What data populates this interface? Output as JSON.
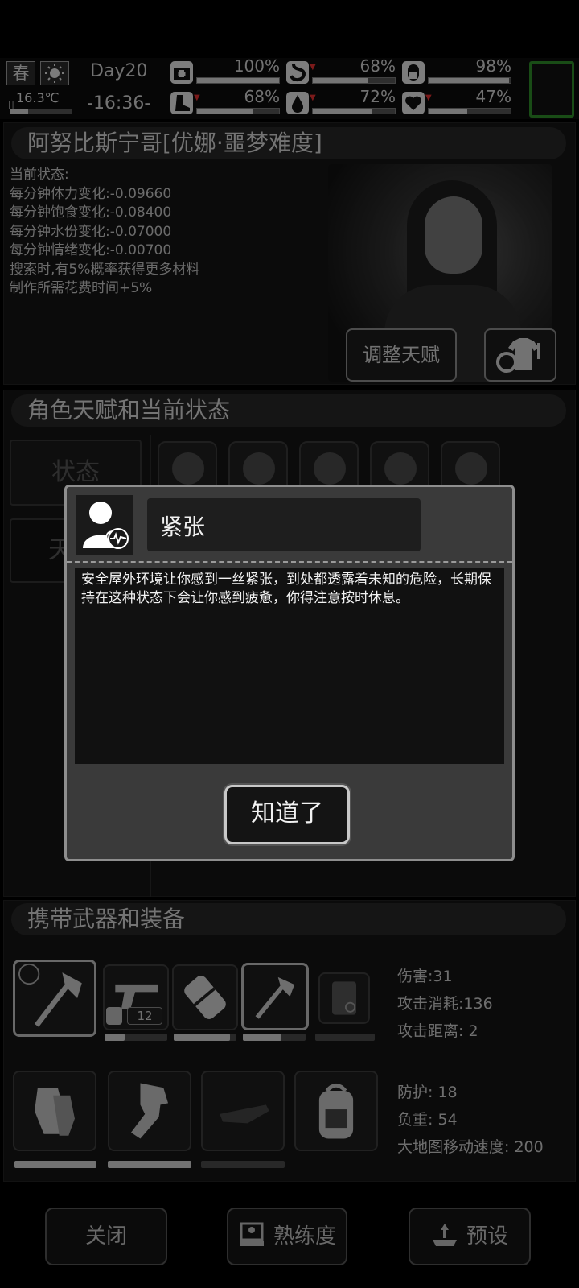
{
  "hud": {
    "season": "春",
    "temperature": "16.3℃",
    "temperature_level": 0.3,
    "day": "Day20",
    "time": "-16:36-",
    "stats": [
      {
        "name": "health",
        "icon": "medkit-icon",
        "value": "100%",
        "level": 1.0,
        "down": false
      },
      {
        "name": "hunger",
        "icon": "stomach-icon",
        "value": "68%",
        "level": 0.68,
        "down": true
      },
      {
        "name": "pill",
        "icon": "pill-icon",
        "value": "98%",
        "level": 0.98,
        "down": false
      },
      {
        "name": "stamina",
        "icon": "boot-icon",
        "value": "68%",
        "level": 0.68,
        "down": true
      },
      {
        "name": "thirst",
        "icon": "water-drop-icon",
        "value": "72%",
        "level": 0.72,
        "down": true
      },
      {
        "name": "mood",
        "icon": "heart-icon",
        "value": "47%",
        "level": 0.47,
        "down": true
      }
    ]
  },
  "character": {
    "name_header": "阿努比斯宁哥[优娜·噩梦难度]",
    "status_lines": [
      "当前状态:",
      "每分钟体力变化:-0.09660",
      "每分钟饱食变化:-0.08400",
      "每分钟水份变化:-0.07000",
      "每分钟情绪变化:-0.00700",
      "搜索时,有5%概率获得更多材料",
      "制作所需花费时间+5%"
    ],
    "adjust_talent_label": "调整天赋"
  },
  "talents_section": {
    "header": "角色天赋和当前状态",
    "tab_state": "状态",
    "tab_talent_partial": "天"
  },
  "dialog": {
    "title": "紧张",
    "body": "安全屋外环境让你感到一丝紧张，到处都透露着未知的危险，长期保持在这种状态下会让你感到疲惫，你得注意按时休息。",
    "ok_label": "知道了"
  },
  "equipment": {
    "header": "携带武器和装备",
    "weapon_durability": [
      0.0,
      0.32,
      0.9,
      0.62,
      0.0
    ],
    "ammo_count": "12",
    "weapon_stats": [
      "伤害:31",
      "攻击消耗:136",
      "攻击距离: 2"
    ],
    "armor_durability": [
      1.0,
      1.0,
      0.0
    ],
    "armor_stats": [
      "防护: 18",
      "负重: 54",
      "大地图移动速度: 200"
    ]
  },
  "footer": {
    "close_label": "关闭",
    "proficiency_label": "熟练度",
    "preset_label": "预设"
  }
}
